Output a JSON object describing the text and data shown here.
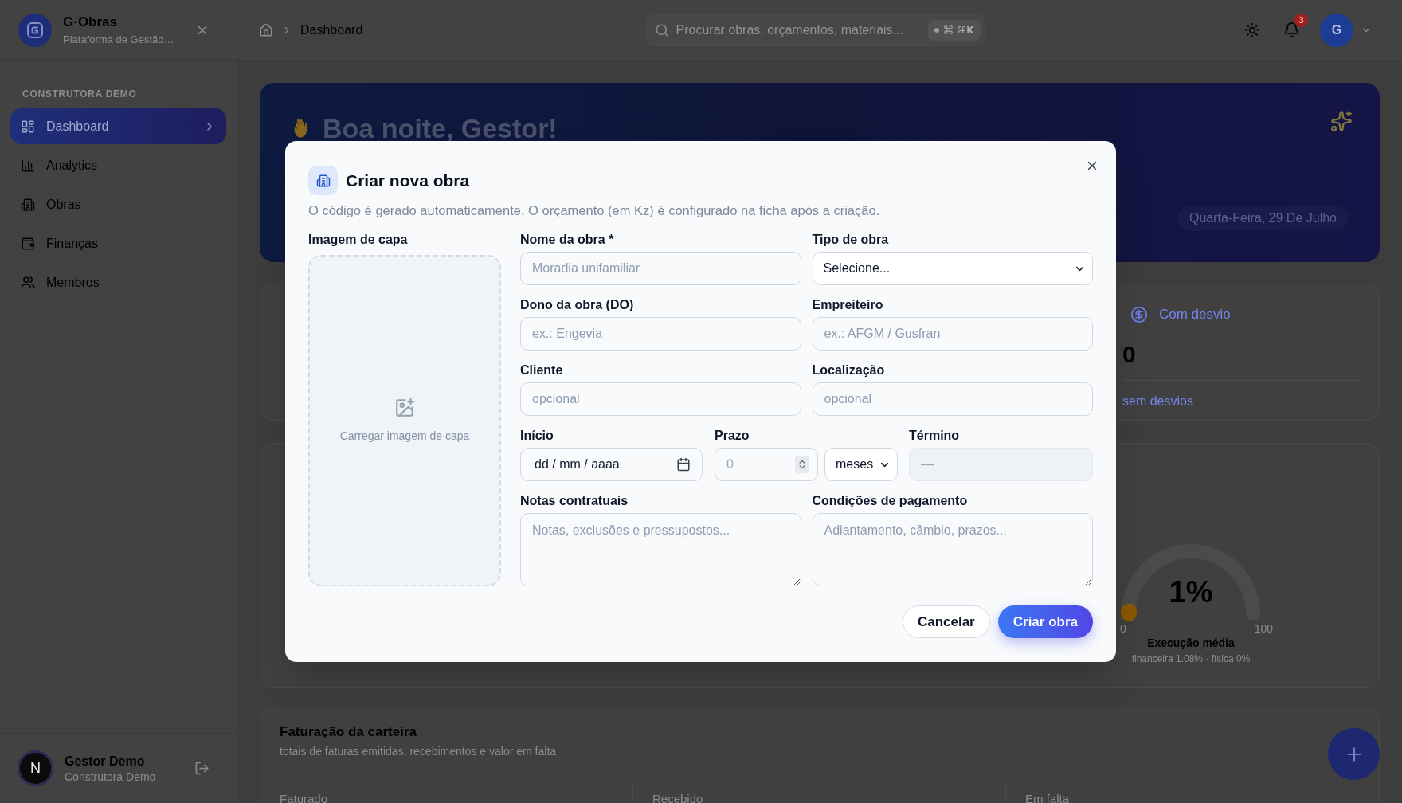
{
  "sidebar": {
    "brand": {
      "name": "G·Obras",
      "subtitle": "Plataforma de Gestão…"
    },
    "section_label": "CONSTRUTORA DEMO",
    "items": [
      {
        "label": "Dashboard",
        "selected": true
      },
      {
        "label": "Analytics",
        "selected": false
      },
      {
        "label": "Obras",
        "selected": false
      },
      {
        "label": "Finanças",
        "selected": false
      },
      {
        "label": "Membros",
        "selected": false
      }
    ],
    "user": {
      "initial": "N",
      "name": "Gestor Demo",
      "organization": "Construtora Demo"
    }
  },
  "topbar": {
    "breadcrumb": [
      {
        "label": "Dashboard"
      }
    ],
    "search": {
      "placeholder": "Procurar obras, orçamentos, materiais...",
      "shortcut": "⌘K"
    },
    "notification_count": "3",
    "avatar_initial": "G"
  },
  "hero": {
    "greeting": "Boa noite, Gestor!",
    "date": "Quarta-Feira, 29 De Julho"
  },
  "deviation_stat": {
    "label": "Com desvio",
    "value": "0",
    "note": "sem desvios"
  },
  "execution_gauge": {
    "value": "1%",
    "level": 0.01,
    "min": "0",
    "max": "100",
    "title": "Execução média",
    "detail": "financeira 1.08% · física 0%"
  },
  "billing": {
    "title": "Faturação da carteira",
    "subtitle": "totais de faturas emitidas, recebimentos e valor em falta",
    "columns": [
      "Faturado",
      "Recebido",
      "Em falta"
    ]
  },
  "modal": {
    "title": "Criar nova obra",
    "description": "O código é gerado automaticamente. O orçamento (em Kz) é configurado na ficha após a criação.",
    "cover": {
      "label": "Imagem de capa",
      "upload_text": "Carregar imagem de capa"
    },
    "rows": [
      [
        {
          "kind": "text",
          "label": "Nome da obra *",
          "placeholder": "Moradia unifamiliar"
        },
        {
          "kind": "select",
          "label": "Tipo de obra",
          "value": "Selecione..."
        }
      ],
      [
        {
          "kind": "text",
          "label": "Dono da obra (DO)",
          "placeholder": "ex.: Engevia"
        },
        {
          "kind": "text",
          "label": "Empreiteiro",
          "placeholder": "ex.: AFGM / Gusfran"
        }
      ],
      [
        {
          "kind": "text",
          "label": "Cliente",
          "placeholder": "opcional"
        },
        {
          "kind": "text",
          "label": "Localização",
          "placeholder": "opcional"
        }
      ],
      [
        {
          "kind": "date",
          "label": "Início",
          "value": "dd / mm / aaaa"
        },
        {
          "kind": "number",
          "label": "Prazo",
          "placeholder": "0"
        },
        {
          "kind": "select",
          "value": "meses"
        },
        {
          "kind": "readonly",
          "label": "Término",
          "placeholder": "—"
        }
      ],
      [
        {
          "kind": "textarea",
          "label": "Notas contratuais",
          "placeholder": "Notas, exclusões e pressupostos..."
        },
        {
          "kind": "textarea",
          "label": "Condições de pagamento",
          "placeholder": "Adiantamento, câmbio, prazos..."
        }
      ]
    ],
    "buttons": [
      {
        "kind": "secondary",
        "label": "Cancelar"
      },
      {
        "kind": "primary",
        "label": "Criar obra"
      }
    ]
  }
}
